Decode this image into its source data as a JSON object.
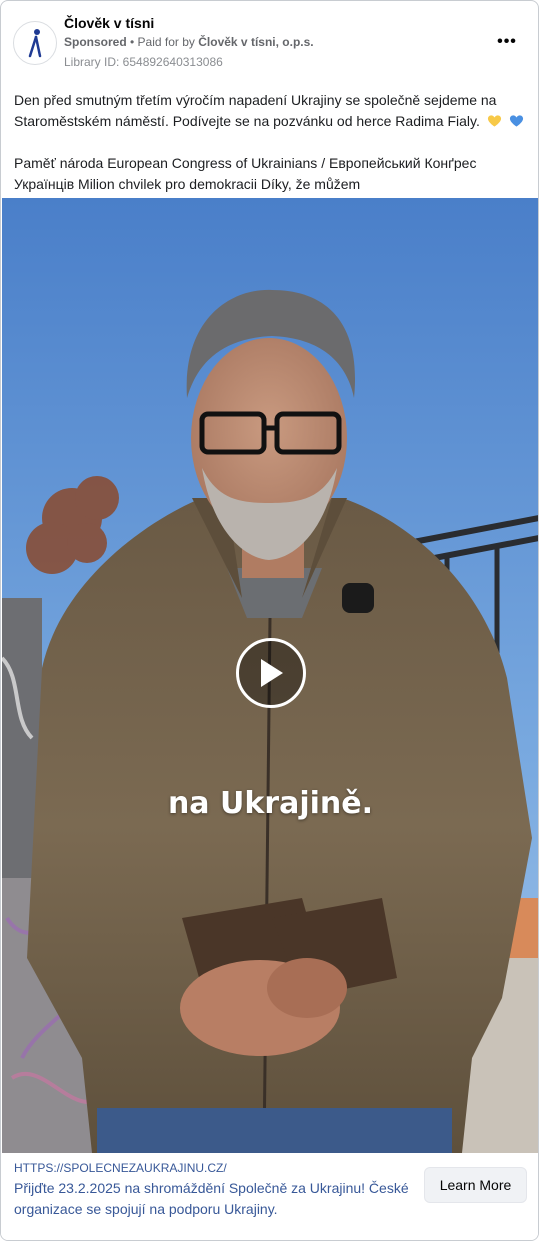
{
  "header": {
    "page_name": "Člověk v tísni",
    "sponsored_label": "Sponsored",
    "paid_for_label": " • Paid for by ",
    "payer_name": "Člověk v tísni, o.p.s.",
    "library_id": "Library ID: 654892640313086",
    "more_glyph": "•••"
  },
  "ad_text": {
    "paragraph1": "Den před smutným třetím výročím napadení Ukrajiny se společně sejdeme na Staroměstském náměstí. Podívejte se na pozvánku od herce Radima Fialy.",
    "paragraph2": "Paměť národa European Congress of Ukrainians / Европейський Конґрес Українців Milion chvilek pro demokracii Díky, že můžem"
  },
  "video": {
    "caption": "na Ukrajině."
  },
  "link": {
    "url": "HTTPS://SPOLECNEZAUKRAJINU.CZ/",
    "title": "Přijďte 23.2.2025 na shromáždění Společně za Ukrajinu! České organizace se spojují na podporu Ukrajiny.",
    "cta_label": "Learn More"
  },
  "colors": {
    "link_blue": "#385898",
    "heart_yellow": "#f7c948",
    "heart_blue": "#4a90e2"
  }
}
